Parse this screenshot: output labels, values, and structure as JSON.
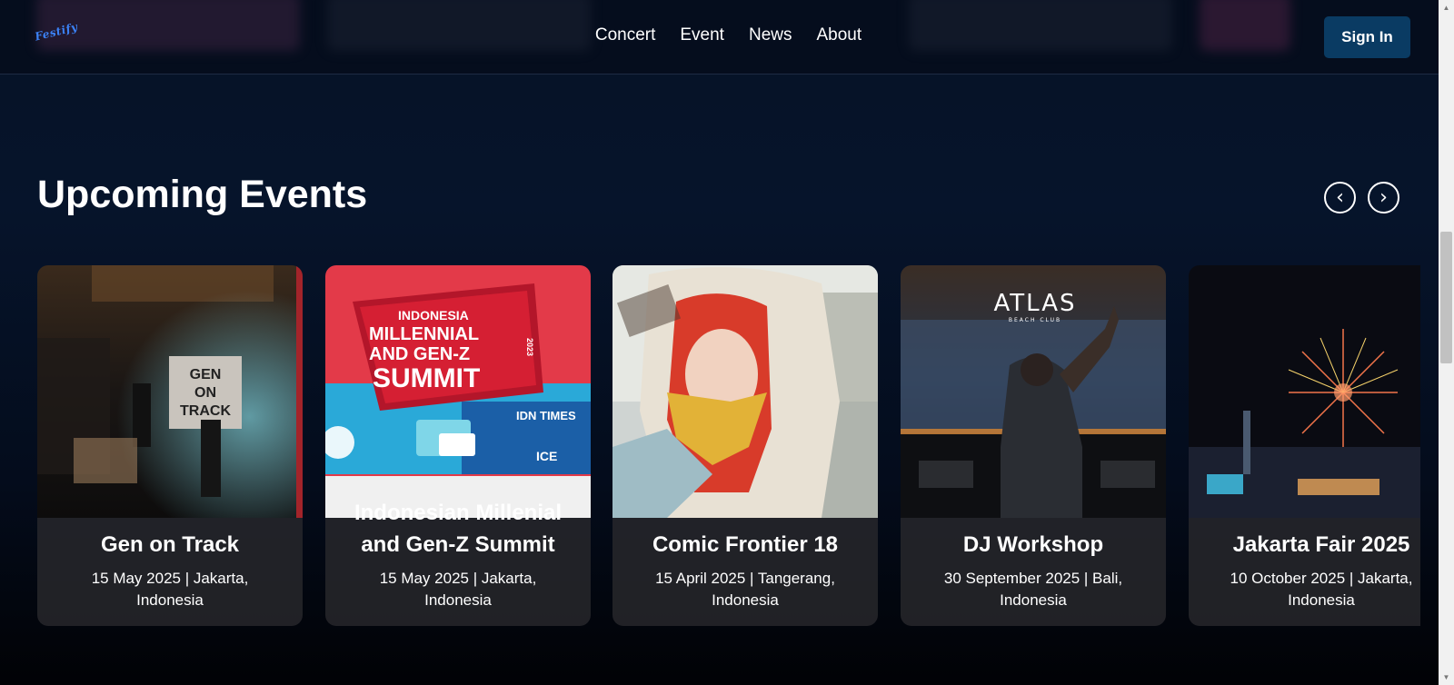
{
  "nav": {
    "logo_text": "Festify",
    "links": [
      "Concert",
      "Event",
      "News",
      "About"
    ],
    "sign_in_label": "Sign In"
  },
  "section": {
    "title": "Upcoming Events",
    "prev_label": "‹",
    "next_label": "›"
  },
  "events": [
    {
      "title": "Gen on Track",
      "date": "15 May 2025",
      "location": "Jakarta, Indonesia",
      "meta": "15 May 2025 | Jakarta, Indonesia"
    },
    {
      "title": "Indonesian Millenial and Gen-Z Summit",
      "date": "15 May 2025",
      "location": "Jakarta, Indonesia",
      "meta": "15 May 2025 | Jakarta, Indonesia"
    },
    {
      "title": "Comic Frontier 18",
      "date": "15 April 2025",
      "location": "Tangerang, Indonesia",
      "meta": "15 April 2025 | Tangerang, Indonesia"
    },
    {
      "title": "DJ Workshop",
      "date": "30 September 2025",
      "location": "Bali, Indonesia",
      "meta": "30 September 2025 | Bali, Indonesia"
    },
    {
      "title": "Jakarta Fair 2025",
      "date": "10 October 2025",
      "location": "Jakarta, Indonesia",
      "meta": "10 October 2025 | Jakarta, Indonesia"
    }
  ],
  "image_text": {
    "gen_on_track_sign": "GEN ON TRACK",
    "summit_1": "INDONESIA",
    "summit_2": "MILLENNIAL",
    "summit_3": "AND GEN-Z",
    "summit_4": "SUMMIT",
    "summit_year": "2023",
    "summit_sponsor_1": "IDN TIMES",
    "summit_sponsor_2": "ICE",
    "atlas_logo": "ATLAS",
    "atlas_sub": "BEACH CLUB"
  },
  "colors": {
    "accent": "#0a3b63",
    "background_top": "#061226",
    "logo": "#3b82f6"
  }
}
